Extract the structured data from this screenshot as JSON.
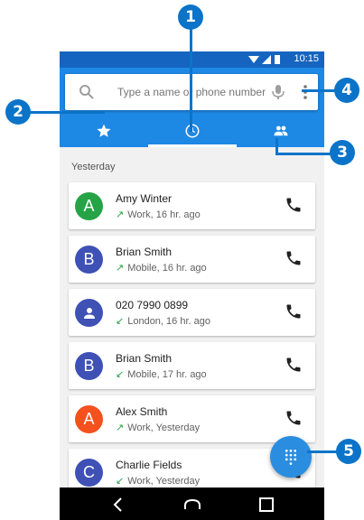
{
  "status_bar": {
    "time": "10:15"
  },
  "search": {
    "placeholder": "Type a name or phone number"
  },
  "tabs": [
    {
      "name": "speed-dial",
      "icon": "star-icon"
    },
    {
      "name": "recents",
      "icon": "clock-icon",
      "active": true
    },
    {
      "name": "contacts",
      "icon": "people-icon"
    }
  ],
  "section_header": "Yesterday",
  "calls": [
    {
      "name": "Amy Winter",
      "avatar_letter": "A",
      "avatar_color": "#26a346",
      "direction": "outgoing",
      "arrow": "↗",
      "detail": "Work, 16 hr. ago"
    },
    {
      "name": "Brian Smith",
      "avatar_letter": "B",
      "avatar_color": "#3f51b5",
      "direction": "outgoing",
      "arrow": "↗",
      "detail": "Mobile, 16 hr. ago"
    },
    {
      "name": "020 7990 0899",
      "avatar_letter": "",
      "avatar_color": "#3f51b5",
      "direction": "incoming",
      "arrow": "↙",
      "detail": "London, 16 hr. ago"
    },
    {
      "name": "Brian Smith",
      "avatar_letter": "B",
      "avatar_color": "#3f51b5",
      "direction": "incoming",
      "arrow": "↙",
      "detail": "Mobile, 17 hr. ago"
    },
    {
      "name": "Alex Smith",
      "avatar_letter": "A",
      "avatar_color": "#f4511e",
      "direction": "outgoing",
      "arrow": "↗",
      "detail": "Work, Yesterday"
    },
    {
      "name": "Charlie Fields",
      "avatar_letter": "C",
      "avatar_color": "#3f51b5",
      "direction": "incoming",
      "arrow": "↙",
      "detail": "Work, Yesterday"
    }
  ],
  "callouts": [
    "1",
    "2",
    "3",
    "4",
    "5"
  ],
  "colors": {
    "primary_dark": "#1565c0",
    "primary": "#1e88e5",
    "accent": "#2a8de0",
    "callout": "#0b74c9",
    "call_arrow": "#26a346"
  }
}
